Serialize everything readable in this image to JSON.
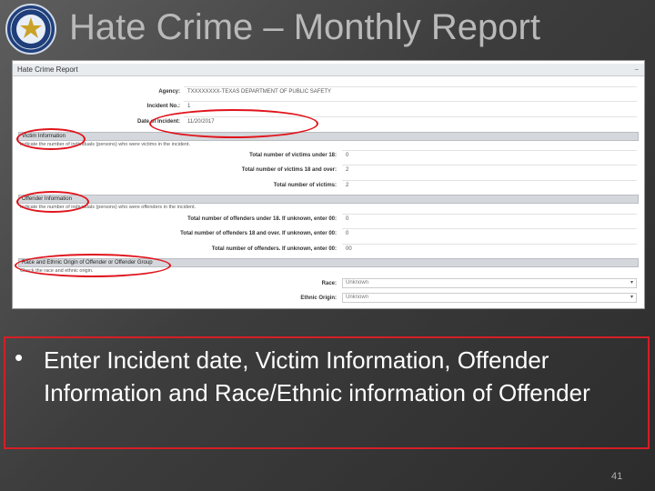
{
  "slide": {
    "title": "Hate Crime – Monthly Report",
    "page_number": "41",
    "logo_icon": "texas-dps-seal-icon"
  },
  "form": {
    "header_title": "Hate Crime Report",
    "agency_label": "Agency:",
    "agency_value": "TXXXXXXXX-TEXAS DEPARTMENT OF PUBLIC SAFETY",
    "incident_no_label": "Incident No.:",
    "incident_no_value": "1",
    "date_label": "Date of Incident:",
    "date_value": "11/20/2017",
    "victim_section": "Victim Information",
    "victim_help": "Indicate the number of individuals (persons) who were victims in the incident.",
    "victims_under_18_label": "Total number of victims under 18:",
    "victims_under_18_value": "0",
    "victims_18_over_label": "Total number of victims 18 and over:",
    "victims_18_over_value": "2",
    "victims_total_label": "Total number of victims:",
    "victims_total_value": "2",
    "offender_section": "Offender Information",
    "offender_help": "Indicate the number of individuals (persons) who were offenders in the incident.",
    "offenders_under_18_label": "Total number of offenders under 18. If unknown, enter 00:",
    "offenders_under_18_value": "0",
    "offenders_18_over_label": "Total number of offenders 18 and over. If unknown, enter 00:",
    "offenders_18_over_value": "0",
    "offenders_total_label": "Total number of offenders. If unknown, enter 00:",
    "offenders_total_value": "00",
    "race_section": "Race and Ethnic Origin of Offender or Offender Group",
    "race_help": "Check the race and ethnic origin.",
    "race_label": "Race:",
    "race_value": "Unknown",
    "ethnic_label": "Ethnic Origin:",
    "ethnic_value": "Unknown"
  },
  "note": {
    "bullet": "•",
    "text": "Enter Incident date, Victim Information, Offender Information and Race/Ethnic information of Offender"
  },
  "colors": {
    "highlight": "#e0141c",
    "note_border": "#d51e26"
  }
}
